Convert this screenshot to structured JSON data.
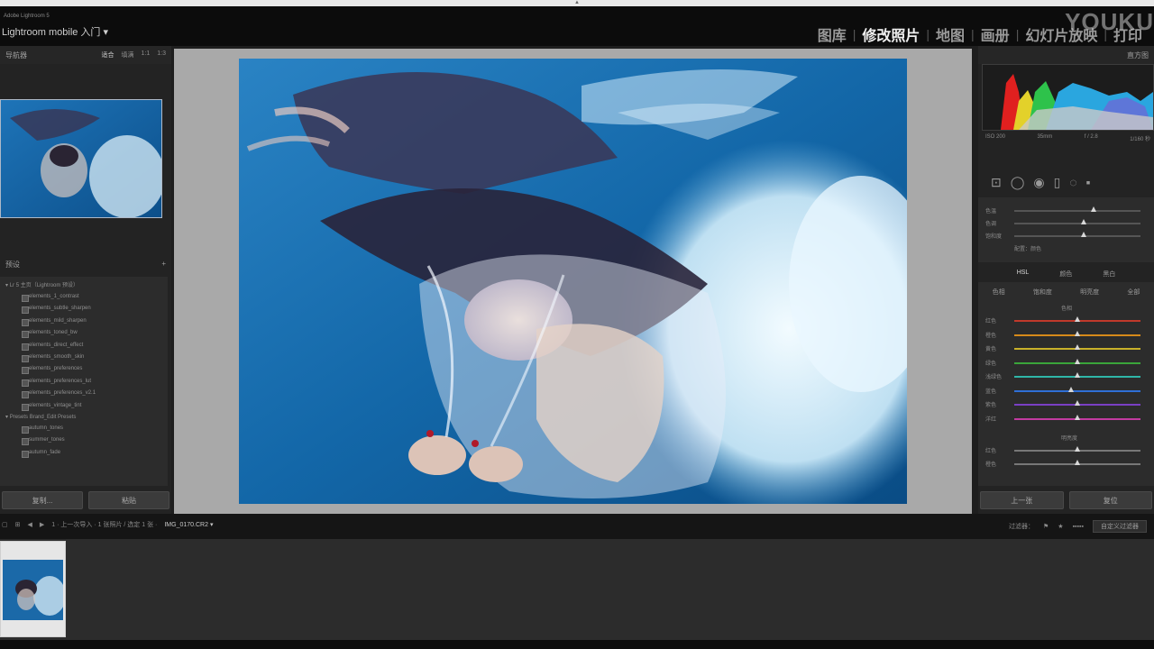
{
  "app": {
    "subtitle": "Adobe Lightroom 5",
    "identity": "Lightroom mobile 入门 ▾"
  },
  "modules": [
    {
      "label": "图库",
      "active": false
    },
    {
      "label": "修改照片",
      "active": true
    },
    {
      "label": "地图",
      "active": false
    },
    {
      "label": "画册",
      "active": false
    },
    {
      "label": "幻灯片放映",
      "active": false
    },
    {
      "label": "打印",
      "active": false
    }
  ],
  "watermark": "YOUKU",
  "navigator": {
    "title": "导航器",
    "options": [
      "适合",
      "填满",
      "1:1",
      "1:3"
    ]
  },
  "presets": {
    "title": "预设",
    "add_icon": "+",
    "folders": [
      {
        "name": "Lr 5 主页（Lightroom 预设）",
        "items": [
          "elements_1_contrast",
          "elements_subtle_sharpen",
          "elements_mild_sharpen",
          "elements_toned_bw",
          "elements_direct_effect",
          "elements_smooth_skin",
          "elements_preferences",
          "elements_preferences_lut",
          "elements_preferences_v2.1",
          "elements_vintage_tint"
        ]
      },
      {
        "name": "Presets Brand_Edit Presets",
        "items": [
          "autumn_tones",
          "summer_tones",
          "autumn_fade"
        ]
      }
    ]
  },
  "left_buttons": {
    "copy": "复制...",
    "paste": "粘贴"
  },
  "histogram": {
    "title": "直方图",
    "info": [
      "ISO 200",
      "35mm",
      "f / 2.8",
      "1/160 秒"
    ]
  },
  "tools": [
    "crop-icon",
    "spot-removal-icon",
    "red-eye-icon",
    "graduated-filter-icon",
    "radial-filter-icon",
    "brush-icon"
  ],
  "basic_sliders": [
    {
      "label": "色温",
      "value": 0.63
    },
    {
      "label": "色调",
      "value": 0.55
    },
    {
      "label": "饱和度",
      "value": 0.55
    }
  ],
  "basic_profile": "配置：颜色",
  "hsl": {
    "tabs": [
      "HSL",
      "颜色",
      "黑白"
    ],
    "subtabs": [
      "色相",
      "饱和度",
      "明亮度",
      "全部"
    ],
    "section_label": "色相",
    "sliders": [
      {
        "label": "红色",
        "value": 0.5,
        "color": "#c0392b"
      },
      {
        "label": "橙色",
        "value": 0.5,
        "color": "#d68a1a"
      },
      {
        "label": "黄色",
        "value": 0.5,
        "color": "#c9b12a"
      },
      {
        "label": "绿色",
        "value": 0.5,
        "color": "#3aa53a"
      },
      {
        "label": "浅绿色",
        "value": 0.5,
        "color": "#2fb6a8"
      },
      {
        "label": "蓝色",
        "value": 0.45,
        "color": "#2f6fd6"
      },
      {
        "label": "紫色",
        "value": 0.5,
        "color": "#7a3fc4"
      },
      {
        "label": "洋红",
        "value": 0.5,
        "color": "#c23ba0"
      }
    ],
    "section2_label": "明亮度",
    "sliders2": [
      {
        "label": "红色",
        "value": 0.5,
        "color": "#777"
      },
      {
        "label": "橙色",
        "value": 0.5,
        "color": "#777"
      }
    ]
  },
  "right_buttons": {
    "previous": "上一张",
    "reset": "复位"
  },
  "filmbar": {
    "left_text": "1 · 上一次导入 · 1 张照片 / 选定 1 张 · ",
    "filename": "IMG_0170.CR2 ▾",
    "filter_label": "过滤器：",
    "custom_filter": "自定义过滤器"
  },
  "colors": {
    "accent": "#2d7fbf",
    "panel": "#2c2c2c",
    "background": "#1e1e1e"
  }
}
